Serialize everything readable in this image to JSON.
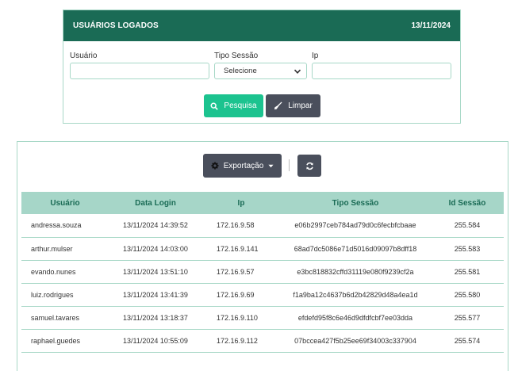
{
  "header": {
    "title": "USUÁRIOS LOGADOS",
    "date": "13/11/2024"
  },
  "filters": {
    "usuario_label": "Usuário",
    "tipo_sessao_label": "Tipo Sessão",
    "tipo_sessao_value": "Selecione",
    "ip_label": "Ip",
    "search_label": "Pesquisa",
    "clear_label": "Limpar"
  },
  "toolbar": {
    "export_label": "Exportação"
  },
  "table": {
    "columns": [
      "Usuário",
      "Data Login",
      "Ip",
      "Tipo Sessão",
      "Id Sessão"
    ],
    "rows": [
      [
        "andressa.souza",
        "13/11/2024 14:39:52",
        "172.16.9.58",
        "e06b2997ceb784ad79d0c6fecbfcbaae",
        "255.584"
      ],
      [
        "arthur.mulser",
        "13/11/2024 14:03:00",
        "172.16.9.141",
        "68ad7dc5086e71d5016d09097b8dff18",
        "255.583"
      ],
      [
        "evando.nunes",
        "13/11/2024 13:51:10",
        "172.16.9.57",
        "e3bc818832cffd31119e080f9239cf2a",
        "255.581"
      ],
      [
        "luiz.rodrigues",
        "13/11/2024 13:41:39",
        "172.16.9.69",
        "f1a9ba12c4637b6d2b42829d48a4ea1d",
        "255.580"
      ],
      [
        "samuel.tavares",
        "13/11/2024 13:18:37",
        "172.16.9.110",
        "efdefd95f8c6e46d9dfdfcbf7ee03dda",
        "255.577"
      ],
      [
        "raphael.guedes",
        "13/11/2024 10:55:09",
        "172.16.9.112",
        "07bccea427f5b25ee69f34003c337904",
        "255.574"
      ]
    ]
  },
  "colors": {
    "header_bg": "#1a6b55",
    "accent_green": "#1cc38f",
    "dark_button": "#4a4f5c",
    "table_header_bg": "#a6d6c8"
  },
  "icons": {
    "search": "search-icon",
    "clear": "broom-icon",
    "export": "gear-icon",
    "caret": "caret-down-icon",
    "refresh": "refresh-icon"
  }
}
